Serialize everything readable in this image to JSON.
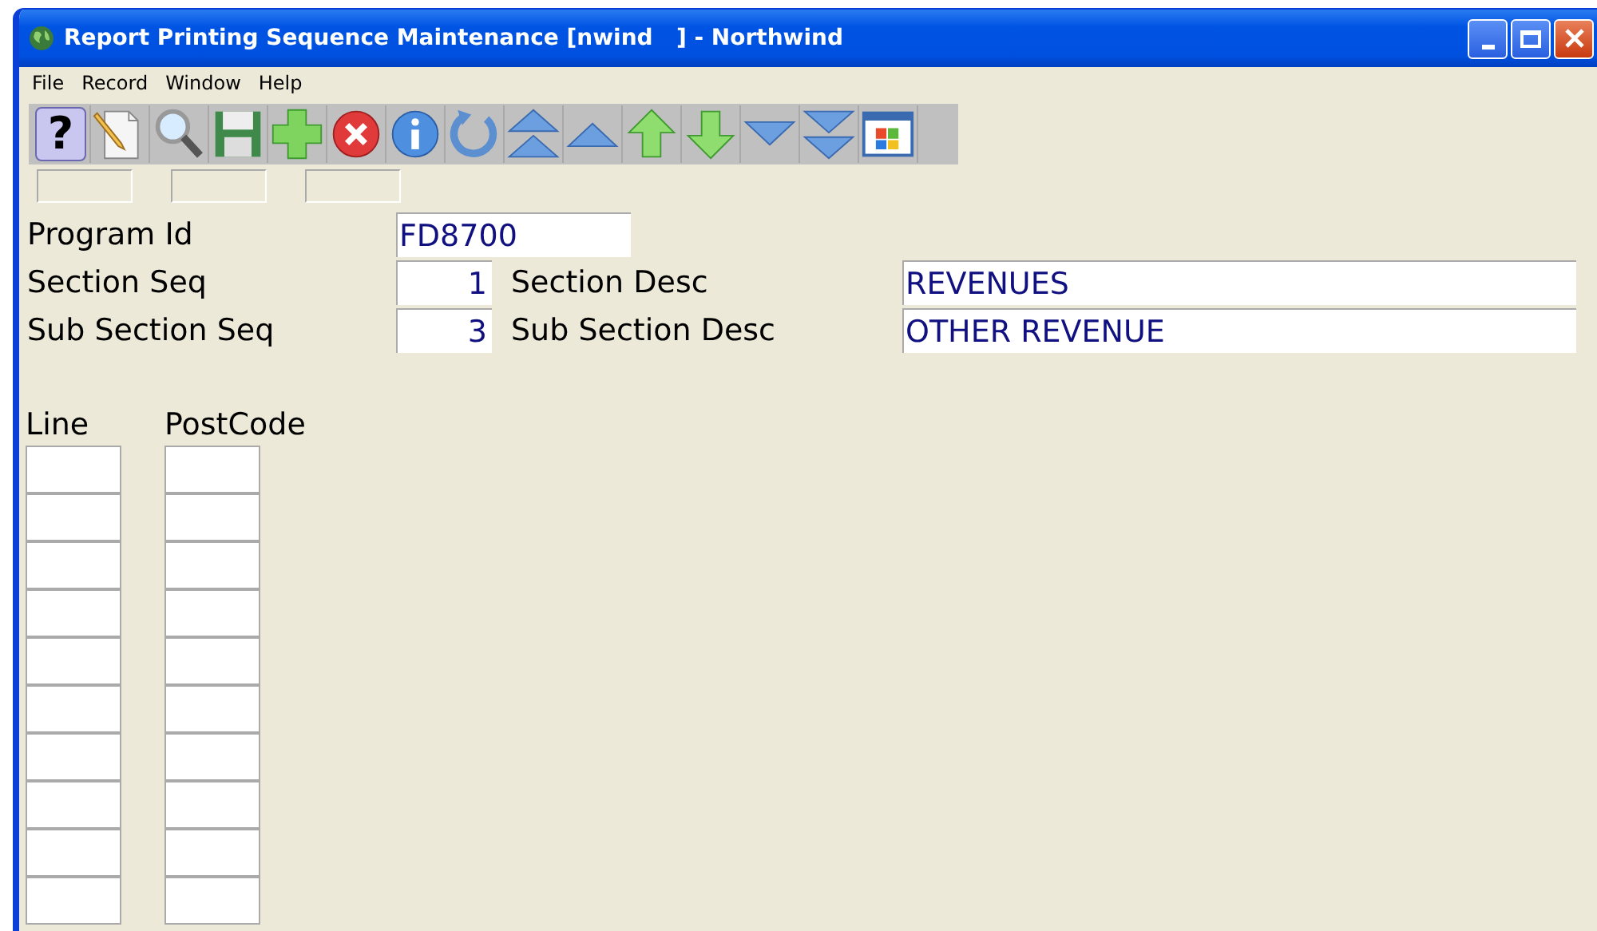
{
  "window": {
    "title": "Report Printing Sequence Maintenance [nwind   ] - Northwind"
  },
  "menu": [
    "File",
    "Record",
    "Window",
    "Help"
  ],
  "toolbar": [
    {
      "kind": "help",
      "label": "?"
    },
    {
      "kind": "new"
    },
    {
      "kind": "search"
    },
    {
      "kind": "save"
    },
    {
      "kind": "add"
    },
    {
      "kind": "delete"
    },
    {
      "kind": "info"
    },
    {
      "kind": "refresh"
    },
    {
      "kind": "first"
    },
    {
      "kind": "prev"
    },
    {
      "kind": "up"
    },
    {
      "kind": "down"
    },
    {
      "kind": "next"
    },
    {
      "kind": "last"
    },
    {
      "kind": "window"
    }
  ],
  "form": [
    {
      "label": "Program Id",
      "value": "FD8700",
      "kind": "text"
    },
    {
      "label": "Section Seq",
      "value": "1",
      "kind": "number",
      "desc_label": "Section Desc",
      "desc_value": "REVENUES"
    },
    {
      "label": "Sub Section Seq",
      "value": "3",
      "kind": "number",
      "desc_label": "Sub Section Desc",
      "desc_value": "OTHER REVENUE"
    }
  ],
  "grid": {
    "columns": [
      "Line",
      "PostCode"
    ]
  }
}
